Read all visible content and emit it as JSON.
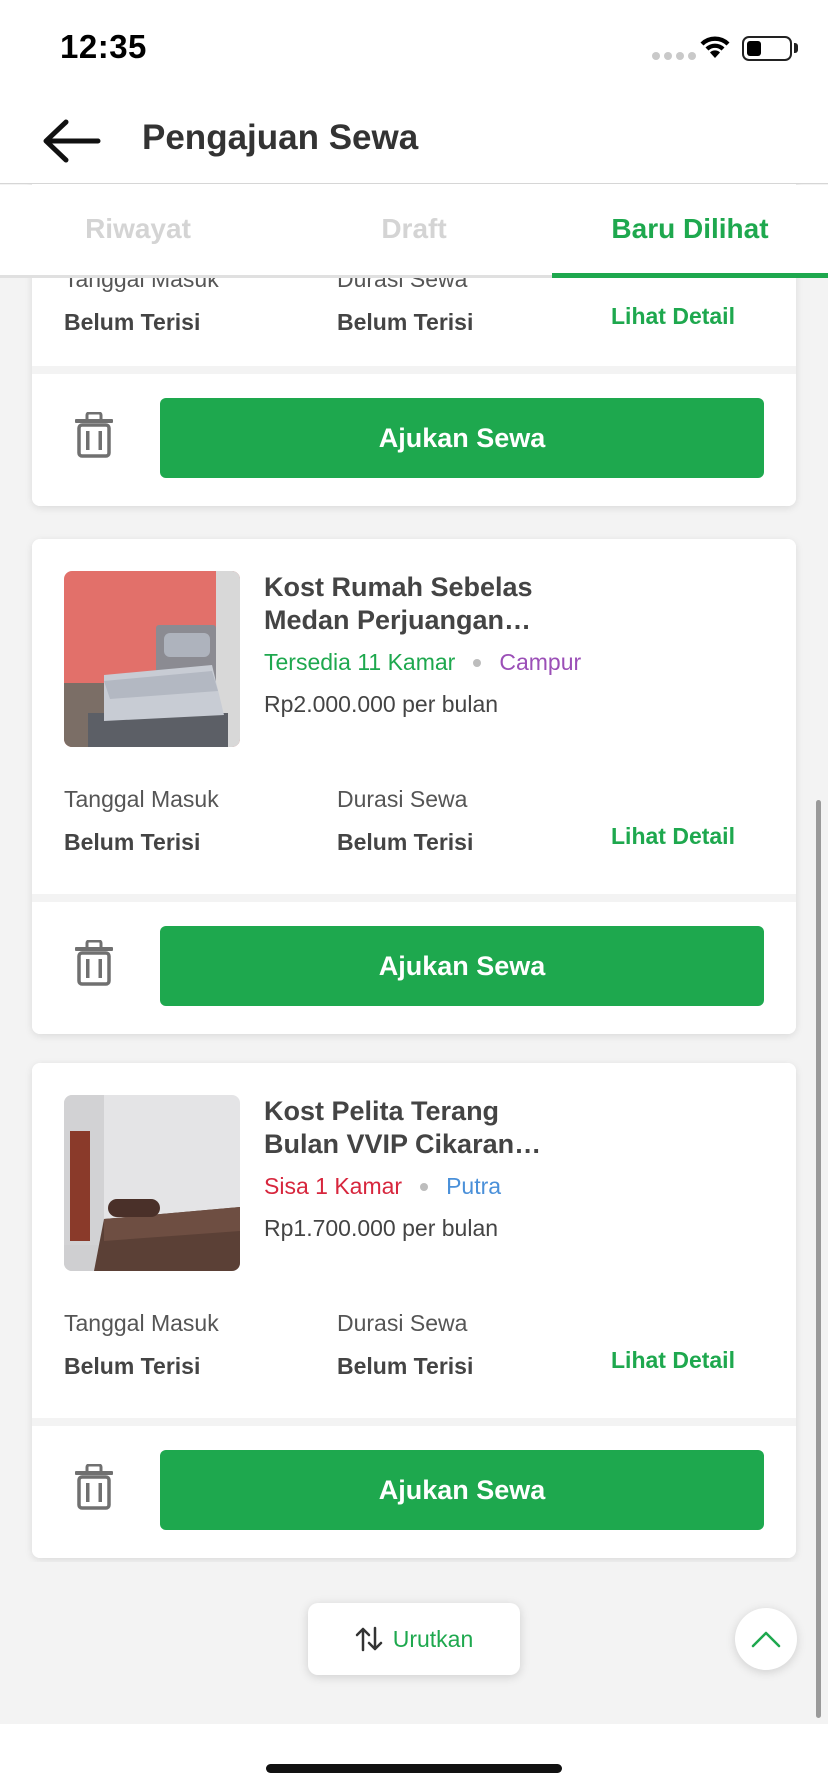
{
  "status_bar": {
    "time": "12:35"
  },
  "header": {
    "title": "Pengajuan Sewa",
    "back_icon": "arrow-left-icon"
  },
  "tabs": [
    {
      "label": "Riwayat",
      "active": false
    },
    {
      "label": "Draft",
      "active": false
    },
    {
      "label": "Baru Dilihat",
      "active": true
    }
  ],
  "cards": [
    {
      "name": "",
      "availability": "",
      "gender": "",
      "price": "",
      "checkin_label": "Tanggal Masuk",
      "checkin_value": "Belum Terisi",
      "duration_label": "Durasi Sewa",
      "duration_value": "Belum Terisi",
      "detail_label": "Lihat Detail",
      "submit_label": "Ajukan Sewa"
    },
    {
      "name": "Kost Rumah Sebelas Medan Perjuangan…",
      "availability": "Tersedia 11 Kamar",
      "availability_color": "#1ea84e",
      "gender": "Campur",
      "gender_color": "#9b4fb7",
      "price": "Rp2.000.000 per bulan",
      "checkin_label": "Tanggal Masuk",
      "checkin_value": "Belum Terisi",
      "duration_label": "Durasi Sewa",
      "duration_value": "Belum Terisi",
      "detail_label": "Lihat Detail",
      "submit_label": "Ajukan Sewa"
    },
    {
      "name": "Kost Pelita Terang Bulan VVIP Cikaran…",
      "availability": "Sisa 1 Kamar",
      "availability_color": "#d7263d",
      "gender": "Putra",
      "gender_color": "#4a90d9",
      "price": "Rp1.700.000 per bulan",
      "checkin_label": "Tanggal Masuk",
      "checkin_value": "Belum Terisi",
      "duration_label": "Durasi Sewa",
      "duration_value": "Belum Terisi",
      "detail_label": "Lihat Detail",
      "submit_label": "Ajukan Sewa"
    }
  ],
  "sort": {
    "label": "Urutkan",
    "icon": "sort-arrows-icon"
  },
  "scroll_top": {
    "icon": "chevron-up-icon"
  },
  "colors": {
    "primary": "#1ea84e",
    "danger": "#d7263d",
    "purple": "#9b4fb7",
    "blue": "#4a90d9"
  }
}
